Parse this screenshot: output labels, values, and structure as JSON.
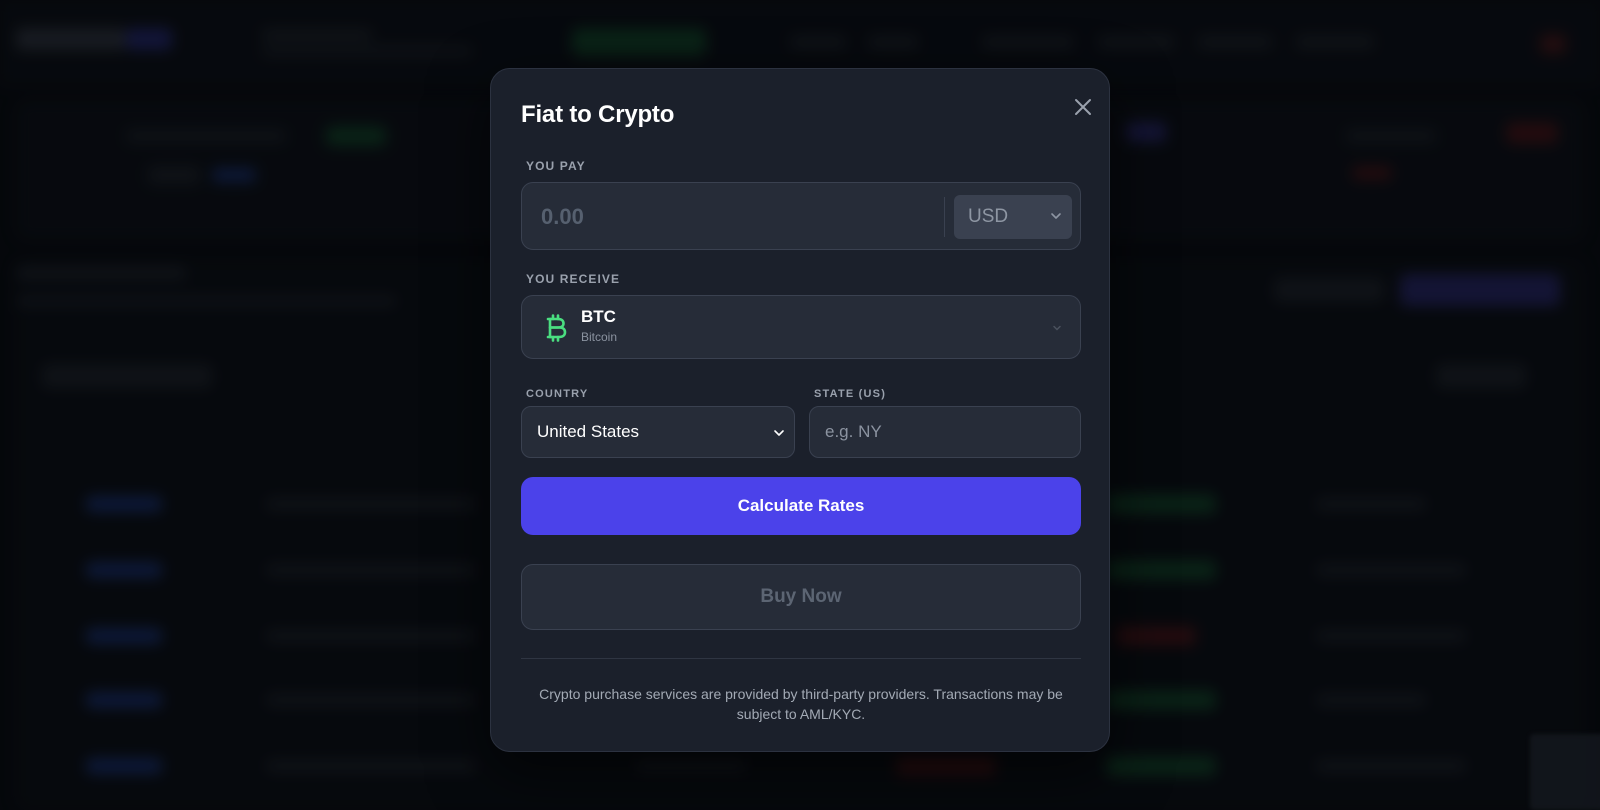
{
  "modal": {
    "title": "Fiat to Crypto",
    "close_icon": "close-icon",
    "pay": {
      "label": "YOU PAY",
      "amount_value": "",
      "amount_placeholder": "0.00",
      "currency": "USD"
    },
    "receive": {
      "label": "YOU RECEIVE",
      "coin_icon": "bitcoin-icon",
      "coin_symbol": "BTC",
      "coin_name": "Bitcoin"
    },
    "country": {
      "label": "COUNTRY",
      "selected": "United States"
    },
    "state": {
      "label": "STATE (US)",
      "value": "",
      "placeholder": "e.g. NY"
    },
    "calculate_button": "Calculate Rates",
    "buy_button": "Buy Now",
    "disclaimer": "Crypto purchase services are provided by third-party providers. Transactions may be subject to AML/KYC."
  },
  "colors": {
    "accent": "#4b42ea",
    "bitcoin_green": "#4ade80",
    "modal_bg": "#1b202b"
  }
}
